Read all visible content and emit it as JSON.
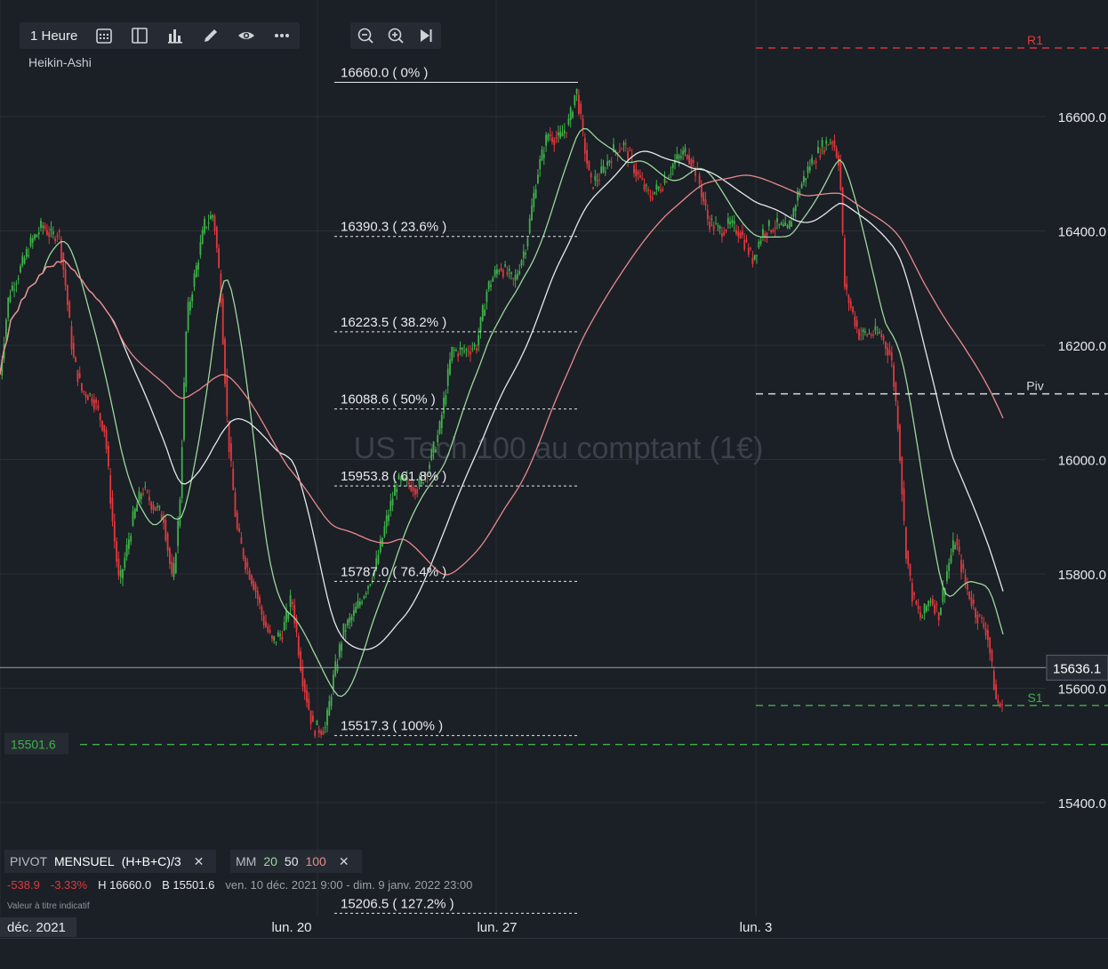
{
  "toolbar": {
    "timeframe": "1 Heure",
    "icons": [
      "calendar-grid-icon",
      "split-layout-icon",
      "bar-chart-icon",
      "pencil-icon",
      "eye-icon",
      "more-icon"
    ],
    "zoom_icons": [
      "zoom-out-icon",
      "zoom-in-icon",
      "jump-to-end-icon"
    ]
  },
  "chart_type_label": "Heikin-Ashi",
  "watermark": "US Tech 100 au comptant (1€)",
  "legend": {
    "pivot_label": "PIVOT",
    "pivot_period": "MENSUEL",
    "pivot_formula": "(H+B+C)/3",
    "ma_label": "MM",
    "ma_periods": [
      "20",
      "50",
      "100"
    ],
    "ma_colors": [
      "#9bd89b",
      "#e6e8eb",
      "#e88a8a"
    ]
  },
  "stats": {
    "change": "-538.9",
    "change_pct": "-3.33%",
    "high": "H 16660.0",
    "low": "B 15501.6",
    "range": "ven. 10 déc. 2021 9:00 - dim. 9 janv. 2022 23:00"
  },
  "disclaimer": "Valeur à titre indicatif",
  "colors": {
    "up": "#3fb24a",
    "down": "#e0393e",
    "background": "#1b1f26",
    "grid": "#2a2f37"
  },
  "chart_data": {
    "type": "candlestick",
    "y_range": [
      15300,
      16730
    ],
    "y_ticks": [
      "16600.0",
      "16400.0",
      "16200.0",
      "16000.0",
      "15800.0",
      "15600.0",
      "15400.0"
    ],
    "x_labels": [
      "déc. 2021",
      "lun. 20",
      "lun. 27",
      "lun. 3"
    ],
    "current_price": 15636.1,
    "current_price_label": "15636.1",
    "low_marker": 15501.6,
    "low_marker_label": "15501.6",
    "pivot_levels": [
      {
        "name": "R1",
        "value": 16720,
        "color": "#e0393e"
      },
      {
        "name": "Piv",
        "value": 16115,
        "color": "#d7dbe0"
      },
      {
        "name": "S1",
        "value": 15570,
        "color": "#3fb24a"
      }
    ],
    "fibonacci": [
      {
        "label": "16660.0 ( 0% )",
        "value": 16660.0
      },
      {
        "label": "16390.3 ( 23.6% )",
        "value": 16390.3
      },
      {
        "label": "16223.5 ( 38.2% )",
        "value": 16223.5
      },
      {
        "label": "16088.6 ( 50% )",
        "value": 16088.6
      },
      {
        "label": "15953.8 ( 61.8% )",
        "value": 15953.8
      },
      {
        "label": "15787.0 ( 76.4% )",
        "value": 15787.0
      },
      {
        "label": "15517.3 ( 100% )",
        "value": 15517.3
      },
      {
        "label": "15206.5 ( 127.2% )",
        "value": 15206.5
      }
    ],
    "price_path": [
      [
        0,
        16150
      ],
      [
        10,
        16290
      ],
      [
        22,
        16330
      ],
      [
        35,
        16380
      ],
      [
        48,
        16410
      ],
      [
        58,
        16390
      ],
      [
        66,
        16400
      ],
      [
        74,
        16300
      ],
      [
        82,
        16180
      ],
      [
        92,
        16120
      ],
      [
        104,
        16110
      ],
      [
        118,
        16050
      ],
      [
        126,
        15900
      ],
      [
        134,
        15780
      ],
      [
        142,
        15840
      ],
      [
        150,
        15900
      ],
      [
        160,
        15950
      ],
      [
        172,
        15920
      ],
      [
        184,
        15900
      ],
      [
        194,
        15780
      ],
      [
        202,
        15920
      ],
      [
        210,
        16250
      ],
      [
        220,
        16330
      ],
      [
        230,
        16410
      ],
      [
        240,
        16430
      ],
      [
        248,
        16300
      ],
      [
        256,
        16050
      ],
      [
        266,
        15880
      ],
      [
        276,
        15820
      ],
      [
        286,
        15780
      ],
      [
        296,
        15720
      ],
      [
        306,
        15680
      ],
      [
        318,
        15700
      ],
      [
        328,
        15760
      ],
      [
        340,
        15620
      ],
      [
        352,
        15530
      ],
      [
        366,
        15530
      ],
      [
        374,
        15610
      ],
      [
        386,
        15700
      ],
      [
        398,
        15730
      ],
      [
        410,
        15770
      ],
      [
        422,
        15810
      ],
      [
        434,
        15890
      ],
      [
        446,
        15960
      ],
      [
        458,
        15960
      ],
      [
        470,
        15950
      ],
      [
        482,
        15990
      ],
      [
        494,
        16050
      ],
      [
        508,
        16190
      ],
      [
        522,
        16190
      ],
      [
        536,
        16200
      ],
      [
        548,
        16300
      ],
      [
        562,
        16340
      ],
      [
        578,
        16310
      ],
      [
        592,
        16380
      ],
      [
        604,
        16500
      ],
      [
        616,
        16570
      ],
      [
        628,
        16560
      ],
      [
        640,
        16590
      ],
      [
        648,
        16650
      ],
      [
        656,
        16560
      ],
      [
        664,
        16480
      ],
      [
        676,
        16500
      ],
      [
        690,
        16540
      ],
      [
        702,
        16550
      ],
      [
        716,
        16500
      ],
      [
        730,
        16460
      ],
      [
        744,
        16480
      ],
      [
        758,
        16520
      ],
      [
        772,
        16540
      ],
      [
        784,
        16500
      ],
      [
        796,
        16420
      ],
      [
        808,
        16400
      ],
      [
        820,
        16410
      ],
      [
        832,
        16400
      ],
      [
        846,
        16350
      ],
      [
        858,
        16400
      ],
      [
        872,
        16410
      ],
      [
        886,
        16400
      ],
      [
        898,
        16470
      ],
      [
        912,
        16520
      ],
      [
        926,
        16550
      ],
      [
        936,
        16560
      ],
      [
        944,
        16520
      ],
      [
        950,
        16300
      ],
      [
        958,
        16260
      ],
      [
        966,
        16220
      ],
      [
        978,
        16220
      ],
      [
        990,
        16220
      ],
      [
        1002,
        16180
      ],
      [
        1010,
        16060
      ],
      [
        1018,
        15850
      ],
      [
        1026,
        15760
      ],
      [
        1036,
        15720
      ],
      [
        1046,
        15760
      ],
      [
        1056,
        15730
      ],
      [
        1064,
        15800
      ],
      [
        1074,
        15860
      ],
      [
        1086,
        15780
      ],
      [
        1098,
        15730
      ],
      [
        1110,
        15700
      ],
      [
        1120,
        15580
      ],
      [
        1128,
        15560
      ]
    ]
  }
}
